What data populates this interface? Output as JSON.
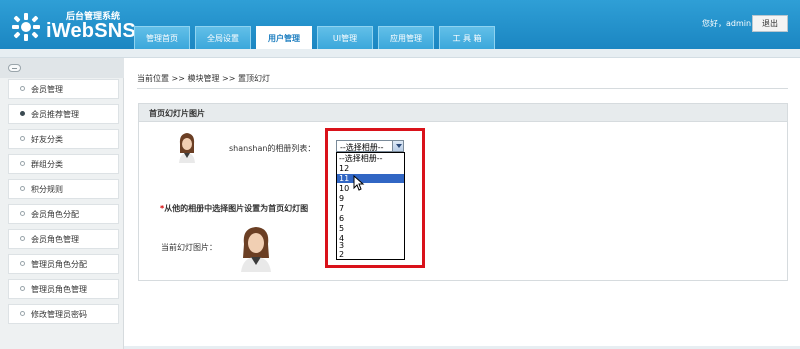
{
  "header": {
    "logo_sub": "后台管理系统",
    "logo_text": "iWebSNS",
    "nav_tabs": [
      "管理首页",
      "全局设置",
      "用户管理",
      "UI管理",
      "应用管理",
      "工 具 箱"
    ],
    "active_tab": "用户管理",
    "greeting": "您好，admin",
    "logout": "退出"
  },
  "sidebar": {
    "items": [
      "会员管理",
      "会员推荐管理",
      "好友分类",
      "群组分类",
      "积分规则",
      "会员角色分配",
      "会员角色管理",
      "管理员角色分配",
      "管理员角色管理",
      "修改管理员密码"
    ],
    "active_item": "会员推荐管理"
  },
  "breadcrumb": "当前位置 >> 模块管理 >> 置顶幻灯",
  "panel": {
    "title": "首页幻灯片图片",
    "album_label": "shanshan的相册列表：",
    "hint_star": "*",
    "hint": "从他的相册中选择图片设置为首页幻灯图",
    "current_label": "当前幻灯图片："
  },
  "album_select": {
    "selected": "--选择相册--",
    "options": [
      "--选择相册--",
      "12",
      "11",
      "10",
      "9",
      "7",
      "6",
      "5",
      "4",
      "3",
      "2"
    ],
    "highlighted": "11"
  },
  "colors": {
    "header_blue": "#1b86c2",
    "highlight": "#d9121a",
    "selection": "#3166c4"
  }
}
